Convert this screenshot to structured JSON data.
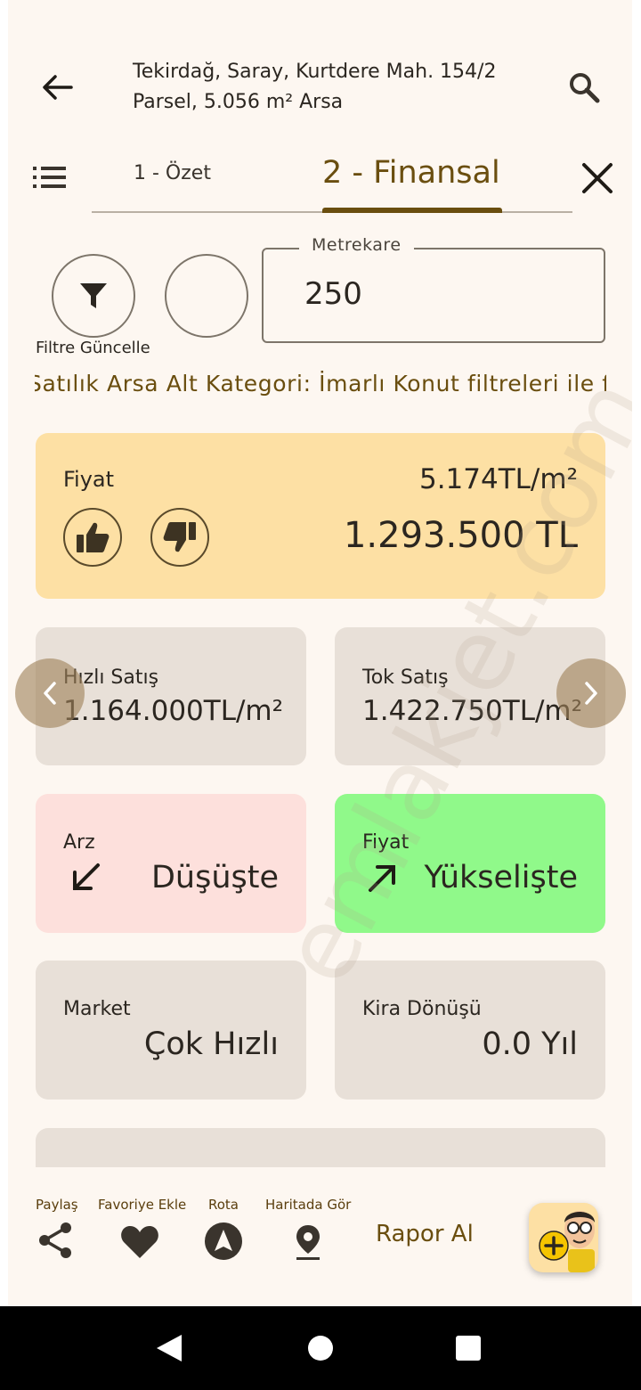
{
  "header": {
    "title": "Tekirdağ, Saray, Kurtdere Mah. 154/2 Parsel, 5.056 m² Arsa",
    "back_icon": "arrow-left-icon",
    "search_icon": "search-icon"
  },
  "tabs": [
    {
      "label": "1 - Özet",
      "active": false
    },
    {
      "label": "2 - Finansal",
      "active": true
    }
  ],
  "filters": {
    "update_label": "Filtre Güncelle",
    "area_label": "Metrekare",
    "area_value": "250",
    "marquee": "Satılık Arsa Alt Kategori: İmarlı Konut filtreleri ile fiyatlandırılmıştır"
  },
  "price_card": {
    "label": "Fiyat",
    "per_m2": "5.174TL/m²",
    "total": "1.293.500 TL"
  },
  "cards": {
    "quick_sale": {
      "label": "Hızlı Satış",
      "value": "1.164.000TL/m²"
    },
    "full_sale": {
      "label": "Tok Satış",
      "value": "1.422.750TL/m²"
    },
    "supply": {
      "label": "Arz",
      "value": "Düşüşte"
    },
    "price_trend": {
      "label": "Fiyat",
      "value": "Yükselişte"
    },
    "market": {
      "label": "Market",
      "value": "Çok Hızlı"
    },
    "rent_return": {
      "label": "Kira Dönüşü",
      "value": "0.0 Yıl"
    }
  },
  "watermark": "emlakjet.com",
  "bottom_bar": {
    "share": "Paylaş",
    "favorite": "Favoriye Ekle",
    "route": "Rota",
    "map": "Haritada Gör",
    "report": "Rapor Al"
  },
  "colors": {
    "accent": "#6a4e0f",
    "price_card": "#fde0a4",
    "supply_card": "#fde0dc",
    "trend_card": "#90f98a",
    "neutral_card": "#e8e0d8"
  }
}
